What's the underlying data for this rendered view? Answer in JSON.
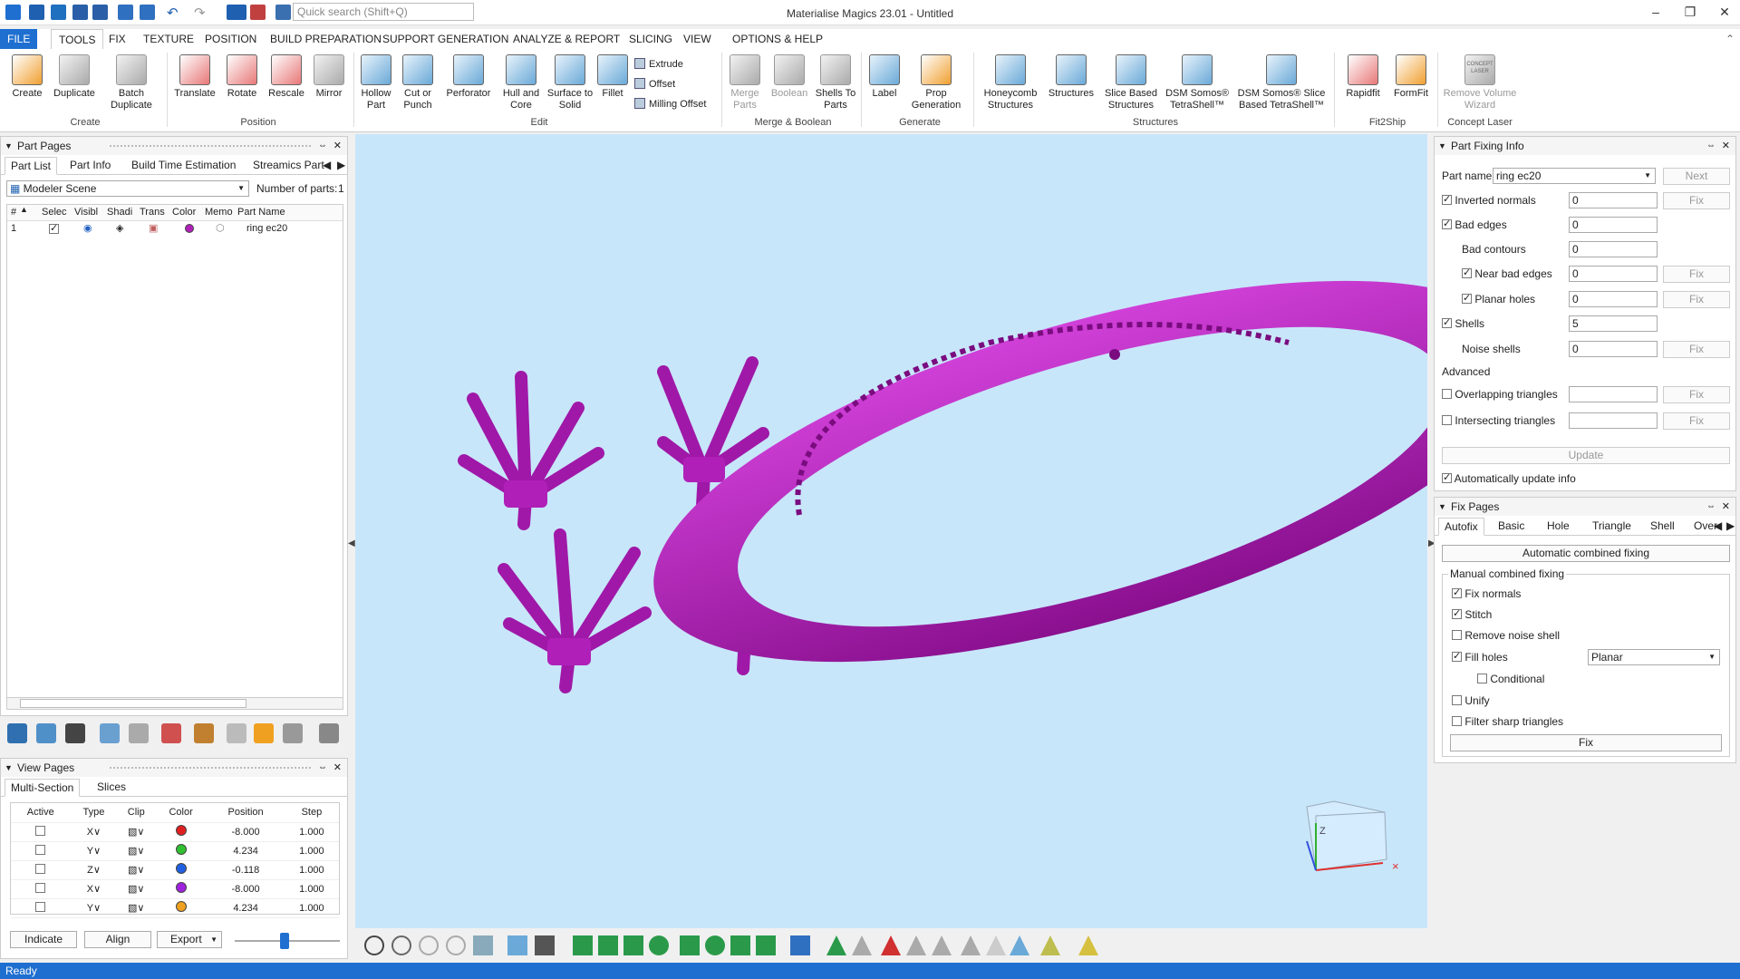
{
  "app": {
    "title": "Materialise Magics 23.01 - Untitled",
    "search_placeholder": "Quick search (Shift+Q)"
  },
  "menu": [
    "FILE",
    "TOOLS",
    "FIX",
    "TEXTURE",
    "POSITION",
    "BUILD PREPARATION",
    "SUPPORT GENERATION",
    "ANALYZE & REPORT",
    "SLICING",
    "VIEW",
    "OPTIONS & HELP"
  ],
  "ribbon": {
    "buttons": [
      "Create",
      "Duplicate",
      "Batch\nDuplicate",
      "Translate",
      "Rotate",
      "Rescale",
      "Mirror",
      "Hollow\nPart",
      "Cut or\nPunch",
      "Perforator",
      "Hull and\nCore",
      "Surface to\nSolid",
      "Fillet",
      "Merge\nParts",
      "Boolean",
      "Shells To\nParts",
      "Label",
      "Prop\nGeneration",
      "Honeycomb\nStructures",
      "Structures",
      "Slice Based\nStructures",
      "DSM Somos®\nTetraShell™",
      "DSM Somos® Slice\nBased TetraShell™",
      "Rapidfit",
      "FormFit",
      "Remove Volume\nWizard"
    ],
    "small": [
      "Extrude",
      "Offset",
      "Milling Offset"
    ],
    "groups": [
      "Create",
      "Position",
      "Edit",
      "Merge & Boolean",
      "Generate",
      "Structures",
      "Fit2Ship",
      "Concept Laser"
    ],
    "concept_badge": "CONCEPT\nLASER"
  },
  "part_pages": {
    "title": "Part Pages",
    "tabs": [
      "Part List",
      "Part Info",
      "Build Time Estimation",
      "Streamics Part"
    ],
    "scene": "Modeler Scene",
    "num_parts_label": "Number of parts:",
    "num_parts": "1",
    "columns": [
      "#",
      "Selec",
      "Visibl",
      "Shadi",
      "Trans",
      "Color",
      "Memo",
      "Part Name"
    ],
    "rows": [
      {
        "num": "1",
        "name": "ring ec20"
      }
    ]
  },
  "view_pages": {
    "title": "View Pages",
    "tabs": [
      "Multi-Section",
      "Slices"
    ],
    "columns": [
      "Active",
      "Type",
      "Clip",
      "Color",
      "Position",
      "Step"
    ],
    "rows": [
      {
        "type": "X∨",
        "color": "#e02020",
        "position": "-8.000",
        "step": "1.000"
      },
      {
        "type": "Y∨",
        "color": "#30c030",
        "position": "4.234",
        "step": "1.000"
      },
      {
        "type": "Z∨",
        "color": "#2060e0",
        "position": "-0.118",
        "step": "1.000"
      },
      {
        "type": "X∨",
        "color": "#a020e0",
        "position": "-8.000",
        "step": "1.000"
      },
      {
        "type": "Y∨",
        "color": "#f0a020",
        "position": "4.234",
        "step": "1.000"
      }
    ],
    "buttons": [
      "Indicate",
      "Align",
      "Export"
    ]
  },
  "part_fixing": {
    "title": "Part Fixing Info",
    "part_name_label": "Part name",
    "part_name": "ring ec20",
    "next": "Next",
    "rows": [
      {
        "label": "Inverted normals",
        "value": "0",
        "check": true,
        "fix": true
      },
      {
        "label": "Bad edges",
        "value": "0",
        "check": true,
        "fix": false
      },
      {
        "label": "Bad contours",
        "value": "0",
        "check": null,
        "fix": false
      },
      {
        "label": "Near bad edges",
        "value": "0",
        "check": true,
        "fix": true
      },
      {
        "label": "Planar holes",
        "value": "0",
        "check": true,
        "fix": true
      },
      {
        "label": "Shells",
        "value": "5",
        "check": true,
        "fix": false
      },
      {
        "label": "Noise shells",
        "value": "0",
        "check": null,
        "fix": true
      }
    ],
    "advanced": "Advanced",
    "adv_rows": [
      {
        "label": "Overlapping triangles"
      },
      {
        "label": "Intersecting triangles"
      }
    ],
    "fix_label": "Fix",
    "update": "Update",
    "auto_update": "Automatically update info"
  },
  "fix_pages": {
    "title": "Fix Pages",
    "tabs": [
      "Autofix",
      "Basic",
      "Hole",
      "Triangle",
      "Shell",
      "Over"
    ],
    "auto_btn": "Automatic combined fixing",
    "group": "Manual combined fixing",
    "options": [
      {
        "label": "Fix normals",
        "on": true
      },
      {
        "label": "Stitch",
        "on": true
      },
      {
        "label": "Remove noise shell",
        "on": false
      },
      {
        "label": "Fill holes",
        "on": true
      },
      {
        "label": "Conditional",
        "on": false
      },
      {
        "label": "Unify",
        "on": false
      },
      {
        "label": "Filter sharp triangles",
        "on": false
      }
    ],
    "fill_mode": "Planar",
    "fix_btn": "Fix"
  },
  "status": "Ready",
  "colors": {
    "accent": "#1f6fd0",
    "part": "#b020b8",
    "viewport": "#c8e6fa"
  }
}
